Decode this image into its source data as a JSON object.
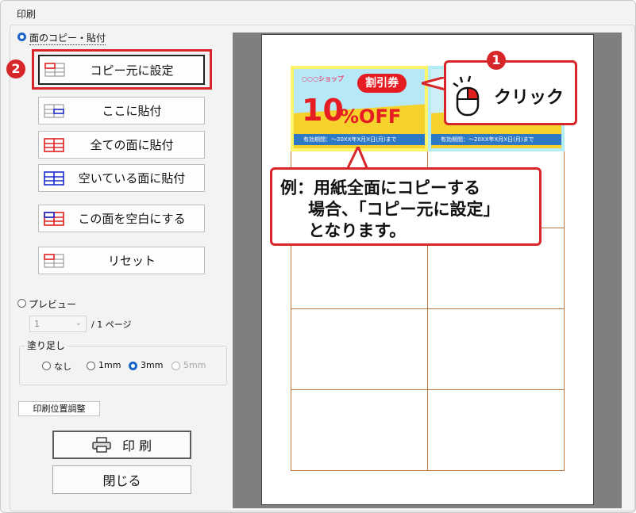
{
  "window": {
    "title": "印刷"
  },
  "mode": {
    "face_copy_label": "面のコピー・貼付",
    "preview_label": "プレビュー"
  },
  "buttons": {
    "set_source": "コピー元に設定",
    "paste_here": "ここに貼付",
    "paste_all": "全ての面に貼付",
    "paste_empty": "空いている面に貼付",
    "make_blank": "この面を空白にする",
    "reset": "リセット"
  },
  "preview": {
    "page_value": "1",
    "page_total": "/ 1 ページ"
  },
  "bleed": {
    "title": "塗り足し",
    "options": [
      "なし",
      "1mm",
      "3mm",
      "5mm"
    ],
    "selected": "3mm"
  },
  "print_position_button": "印刷位置調整",
  "print_button": "印 刷",
  "close_button": "閉じる",
  "coupon": {
    "shop": "○○○ショップ",
    "badge": "割引券",
    "discount_number": "10",
    "discount_unit": "%OFF",
    "validity": "有効期間：～20XX年X月X日(月)まで"
  },
  "annotations": {
    "step1_number": "1",
    "step1_text": "クリック",
    "step2_number": "2",
    "note_lines": [
      "例：用紙全面にコピーする",
      "場合、「コピー元に設定」",
      "となります。"
    ]
  },
  "colors": {
    "accent_red": "#d6262a",
    "radio_blue": "#1b64c8",
    "coupon_yellow": "#fff36b",
    "coupon_cyan": "#b4ecf6",
    "grid_orange": "#b8743a"
  }
}
